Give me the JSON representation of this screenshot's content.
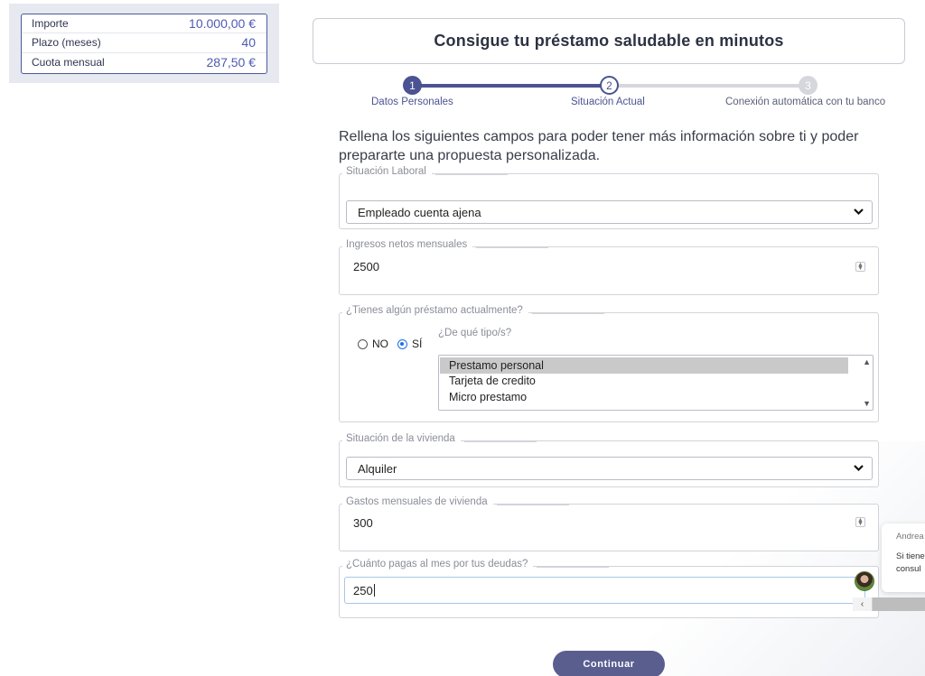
{
  "summary": {
    "rows": [
      {
        "label": "Importe",
        "value": "10.000,00 €"
      },
      {
        "label": "Plazo (meses)",
        "value": "40"
      },
      {
        "label": "Cuota mensual",
        "value": "287,50 €"
      }
    ]
  },
  "header": {
    "title": "Consigue tu préstamo saludable en minutos"
  },
  "stepper": {
    "steps": [
      {
        "number": "1",
        "label": "Datos Personales"
      },
      {
        "number": "2",
        "label": "Situación Actual"
      },
      {
        "number": "3",
        "label": "Conexión automática con tu banco"
      }
    ]
  },
  "form": {
    "intro": "Rellena los siguientes campos para poder tener más información sobre ti y poder prepararte una propuesta personalizada.",
    "situacion_laboral": {
      "legend": "Situación Laboral",
      "value": "Empleado cuenta ajena"
    },
    "ingresos": {
      "legend": "Ingresos netos mensuales",
      "value": "2500"
    },
    "prestamo": {
      "legend": "¿Tienes algún préstamo actualmente?",
      "options": [
        "NO",
        "SÍ"
      ],
      "selected": "SÍ",
      "subquestion": "¿De qué tipo/s?",
      "types": [
        "Prestamo personal",
        "Tarjeta de credito",
        "Micro prestamo"
      ],
      "selected_type": "Prestamo personal"
    },
    "vivienda": {
      "legend": "Situación de la vivienda",
      "value": "Alquiler"
    },
    "gastos_vivienda": {
      "legend": "Gastos mensuales de vivienda",
      "value": "300"
    },
    "deudas": {
      "legend": "¿Cuánto pagas al mes por tus deudas?",
      "value": "250"
    },
    "continue_label": "Continuar"
  },
  "chat": {
    "agent_name": "Andrea",
    "message_lines": [
      "Si tiene",
      "consul"
    ],
    "toggle_glyph": "‹"
  },
  "colors": {
    "accent": "#4b5392",
    "button": "#5a5e8f",
    "value_text": "#4e5bb0"
  }
}
